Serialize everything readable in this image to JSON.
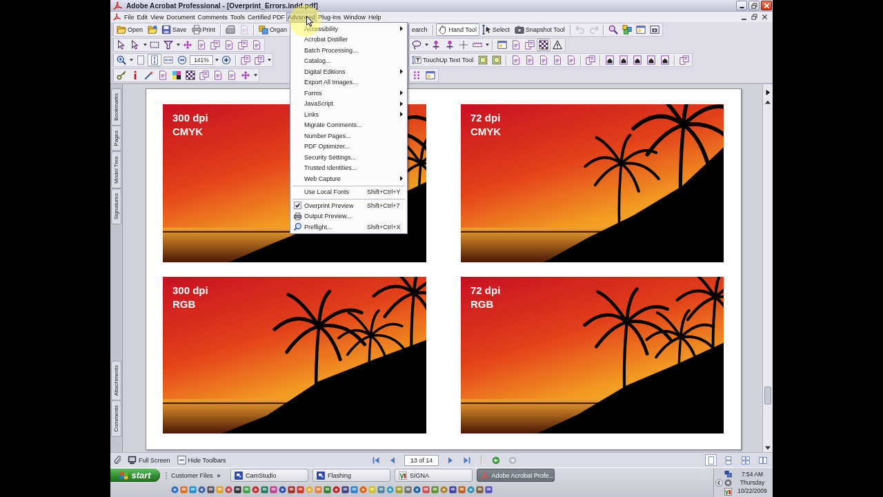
{
  "window": {
    "title": "Adobe Acrobat Professional - [Overprint_Errors.indd.pdf]"
  },
  "menu_bar": [
    {
      "label": "File",
      "selected": false
    },
    {
      "label": "Edit",
      "selected": false
    },
    {
      "label": "View",
      "selected": false
    },
    {
      "label": "Document",
      "selected": false
    },
    {
      "label": "Comments",
      "selected": false
    },
    {
      "label": "Tools",
      "selected": false
    },
    {
      "label": "Certified PDF",
      "selected": false
    },
    {
      "label": "Advanced",
      "selected": true
    },
    {
      "label": "Plug-Ins",
      "selected": false
    },
    {
      "label": "Window",
      "selected": false
    },
    {
      "label": "Help",
      "selected": false
    }
  ],
  "toolbars": [
    {
      "left": [
        {
          "kind": "button",
          "label": "Open",
          "pressed": false,
          "disabled": false
        },
        {
          "kind": "icon",
          "pressed": false,
          "disabled": false
        },
        {
          "kind": "button",
          "label": "Save",
          "pressed": false,
          "disabled": false
        },
        {
          "kind": "button",
          "label": "Print",
          "pressed": false,
          "disabled": false
        },
        {
          "kind": "separator"
        },
        {
          "kind": "icon",
          "pressed": false,
          "disabled": false
        },
        {
          "kind": "icon",
          "pressed": false,
          "disabled": true
        },
        {
          "kind": "separator"
        },
        {
          "kind": "button",
          "label": "Organ",
          "pressed": false,
          "disabled": false
        }
      ],
      "right": [
        {
          "kind": "button",
          "label": "earch",
          "pressed": false,
          "disabled": false
        },
        {
          "kind": "separator"
        },
        {
          "kind": "button",
          "label": "Hand Tool",
          "pressed": true,
          "disabled": false
        },
        {
          "kind": "button",
          "label": "Select",
          "pressed": false,
          "disabled": false
        },
        {
          "kind": "button",
          "label": "Snapshot Tool",
          "pressed": false,
          "disabled": false
        },
        {
          "kind": "separator"
        },
        {
          "kind": "icon",
          "pressed": false,
          "disabled": true
        },
        {
          "kind": "icon",
          "pressed": false,
          "disabled": true
        },
        {
          "kind": "separator"
        },
        {
          "kind": "icon",
          "pressed": false,
          "disabled": false
        },
        {
          "kind": "icon",
          "pressed": false,
          "disabled": false
        },
        {
          "kind": "icon",
          "pressed": false,
          "disabled": false
        },
        {
          "kind": "icon",
          "pressed": false,
          "disabled": false
        }
      ]
    },
    {
      "left": [
        {
          "kind": "icon",
          "pressed": false,
          "disabled": false
        },
        {
          "kind": "icon",
          "pressed": false,
          "disabled": false
        },
        {
          "kind": "dropdown",
          "pressed": false,
          "disabled": false
        },
        {
          "kind": "icon",
          "pressed": false,
          "disabled": false
        },
        {
          "kind": "icon",
          "pressed": false,
          "disabled": false
        },
        {
          "kind": "dropdown",
          "pressed": false,
          "disabled": false
        },
        {
          "kind": "icon",
          "pressed": false,
          "disabled": false
        },
        {
          "kind": "icon",
          "pressed": false,
          "disabled": false
        },
        {
          "kind": "icon",
          "pressed": false,
          "disabled": false
        },
        {
          "kind": "icon",
          "pressed": false,
          "disabled": false
        },
        {
          "kind": "icon",
          "pressed": false,
          "disabled": false
        },
        {
          "kind": "icon",
          "pressed": false,
          "disabled": false
        }
      ],
      "right": [
        {
          "kind": "icon",
          "pressed": false,
          "disabled": false
        },
        {
          "kind": "dropdown",
          "pressed": false,
          "disabled": false
        },
        {
          "kind": "icon",
          "pressed": false,
          "disabled": false
        },
        {
          "kind": "icon",
          "pressed": false,
          "disabled": false
        },
        {
          "kind": "icon",
          "pressed": false,
          "disabled": false
        },
        {
          "kind": "icon",
          "pressed": false,
          "disabled": false
        },
        {
          "kind": "dropdown",
          "pressed": false,
          "disabled": false
        },
        {
          "kind": "separator"
        },
        {
          "kind": "icon",
          "pressed": false,
          "disabled": false
        },
        {
          "kind": "icon",
          "pressed": false,
          "disabled": false
        },
        {
          "kind": "icon",
          "pressed": false,
          "disabled": false
        },
        {
          "kind": "icon",
          "pressed": true,
          "disabled": false
        },
        {
          "kind": "icon",
          "pressed": false,
          "disabled": false
        }
      ]
    },
    {
      "left": [
        {
          "kind": "icon",
          "pressed": false,
          "disabled": false
        },
        {
          "kind": "dropdown",
          "pressed": false,
          "disabled": false
        },
        {
          "kind": "icon",
          "pressed": false,
          "disabled": false
        },
        {
          "kind": "icon",
          "pressed": true,
          "disabled": false
        },
        {
          "kind": "icon",
          "pressed": false,
          "disabled": false
        },
        {
          "kind": "icon",
          "pressed": false,
          "disabled": false
        },
        {
          "kind": "field",
          "value": "141%"
        },
        {
          "kind": "dropdown",
          "pressed": false,
          "disabled": false
        },
        {
          "kind": "icon",
          "pressed": false,
          "disabled": false
        },
        {
          "kind": "separator"
        },
        {
          "kind": "icon",
          "pressed": false,
          "disabled": false
        },
        {
          "kind": "icon",
          "pressed": false,
          "disabled": false
        },
        {
          "kind": "dropdown",
          "pressed": false,
          "disabled": false
        }
      ],
      "right": [
        {
          "kind": "button",
          "label": "TouchUp Text Tool",
          "pressed": false,
          "disabled": false
        },
        {
          "kind": "icon",
          "pressed": false,
          "disabled": false
        },
        {
          "kind": "icon",
          "pressed": false,
          "disabled": false
        },
        {
          "kind": "separator"
        },
        {
          "kind": "icon",
          "pressed": false,
          "disabled": false
        },
        {
          "kind": "icon",
          "pressed": false,
          "disabled": false
        },
        {
          "kind": "icon",
          "pressed": false,
          "disabled": false
        },
        {
          "kind": "icon",
          "pressed": false,
          "disabled": false
        },
        {
          "kind": "icon",
          "pressed": false,
          "disabled": false
        },
        {
          "kind": "separator"
        },
        {
          "kind": "icon",
          "pressed": false,
          "disabled": false
        },
        {
          "kind": "separator"
        },
        {
          "kind": "icon",
          "pressed": false,
          "disabled": false
        },
        {
          "kind": "icon",
          "pressed": false,
          "disabled": false
        },
        {
          "kind": "icon",
          "pressed": false,
          "disabled": false
        },
        {
          "kind": "icon",
          "pressed": false,
          "disabled": false
        },
        {
          "kind": "icon",
          "pressed": false,
          "disabled": false
        },
        {
          "kind": "separator"
        },
        {
          "kind": "icon",
          "pressed": false,
          "disabled": false
        }
      ]
    },
    {
      "left": [
        {
          "kind": "icon",
          "pressed": false,
          "disabled": false
        },
        {
          "kind": "icon",
          "pressed": false,
          "disabled": false
        },
        {
          "kind": "icon",
          "pressed": false,
          "disabled": false
        },
        {
          "kind": "icon",
          "pressed": false,
          "disabled": false
        },
        {
          "kind": "icon",
          "pressed": false,
          "disabled": false
        },
        {
          "kind": "icon",
          "pressed": false,
          "disabled": false
        },
        {
          "kind": "icon",
          "pressed": false,
          "disabled": false
        },
        {
          "kind": "icon",
          "pressed": false,
          "disabled": false
        },
        {
          "kind": "icon",
          "pressed": false,
          "disabled": false
        },
        {
          "kind": "icon",
          "pressed": false,
          "disabled": false
        },
        {
          "kind": "dropdown",
          "pressed": false,
          "disabled": false
        }
      ],
      "right": [
        {
          "kind": "icon",
          "pressed": false,
          "disabled": false
        },
        {
          "kind": "icon",
          "pressed": false,
          "disabled": false
        }
      ]
    }
  ],
  "advanced_menu": {
    "items": [
      {
        "kind": "submenu",
        "label": "Accessibility",
        "checked": false
      },
      {
        "kind": "item",
        "label": "Acrobat Distiller",
        "checked": false
      },
      {
        "kind": "item",
        "label": "Batch Processing...",
        "checked": false
      },
      {
        "kind": "item",
        "label": "Catalog...",
        "checked": false
      },
      {
        "kind": "submenu",
        "label": "Digital Editions",
        "checked": false
      },
      {
        "kind": "item",
        "label": "Export All Images...",
        "checked": false
      },
      {
        "kind": "submenu",
        "label": "Forms",
        "checked": false
      },
      {
        "kind": "submenu",
        "label": "JavaScript",
        "checked": false
      },
      {
        "kind": "submenu",
        "label": "Links",
        "checked": false
      },
      {
        "kind": "item",
        "label": "Migrate Comments...",
        "checked": false
      },
      {
        "kind": "item",
        "label": "Number Pages...",
        "checked": false
      },
      {
        "kind": "item",
        "label": "PDF Optimizer...",
        "checked": false
      },
      {
        "kind": "item",
        "label": "Security Settings...",
        "checked": false
      },
      {
        "kind": "item",
        "label": "Trusted Identities...",
        "checked": false
      },
      {
        "kind": "submenu",
        "label": "Web Capture",
        "checked": false
      },
      {
        "kind": "separator"
      },
      {
        "kind": "item",
        "label": "Use Local Fonts",
        "shortcut": "Shift+Ctrl+Y",
        "checked": false
      },
      {
        "kind": "separator"
      },
      {
        "kind": "item",
        "label": "Overprint Preview",
        "shortcut": "Shift+Ctrl+7",
        "checked": true
      },
      {
        "kind": "tool",
        "label": "Output Preview...",
        "checked": false
      },
      {
        "kind": "tool",
        "label": "Preflight...",
        "shortcut": "Shift+Ctrl+X",
        "checked": false
      }
    ]
  },
  "navigation_panel": {
    "top_tabs": [
      {
        "label": "Bookmarks",
        "selected": false
      },
      {
        "label": "Pages",
        "selected": false
      },
      {
        "label": "Model Tree",
        "selected": false
      },
      {
        "label": "Signatures",
        "selected": false
      }
    ],
    "bottom_tabs": [
      {
        "label": "Attachments",
        "selected": false
      },
      {
        "label": "Comments",
        "selected": false
      }
    ]
  },
  "document": {
    "images": [
      {
        "resolution": "300 dpi",
        "color_mode": "CMYK"
      },
      {
        "resolution": "72 dpi",
        "color_mode": "CMYK"
      },
      {
        "resolution": "300 dpi",
        "color_mode": "RGB"
      },
      {
        "resolution": "72 dpi",
        "color_mode": "RGB"
      }
    ]
  },
  "status_bar": {
    "buttons": [
      {
        "label": "Full Screen"
      },
      {
        "label": "Hide Toolbars"
      }
    ],
    "page_field": "13 of 14",
    "history": [
      {
        "disabled": false
      },
      {
        "disabled": true
      }
    ],
    "page_layouts": [
      {
        "selected": true
      },
      {
        "selected": false
      },
      {
        "selected": false
      },
      {
        "selected": false
      }
    ]
  },
  "taskbar": {
    "start_button": "start",
    "toolbar_label": "Customer Files",
    "toolbar_chevron": "»",
    "tasks": [
      {
        "label": "CamStudio",
        "selected": false
      },
      {
        "label": "Flashing",
        "selected": false
      },
      {
        "label": "SIGNA",
        "selected": false
      },
      {
        "label": "Adobe Acrobat Profe...",
        "selected": true
      }
    ],
    "clock": {
      "time": "7:54 AM",
      "day": "Thursday",
      "date": "10/22/2009"
    }
  }
}
